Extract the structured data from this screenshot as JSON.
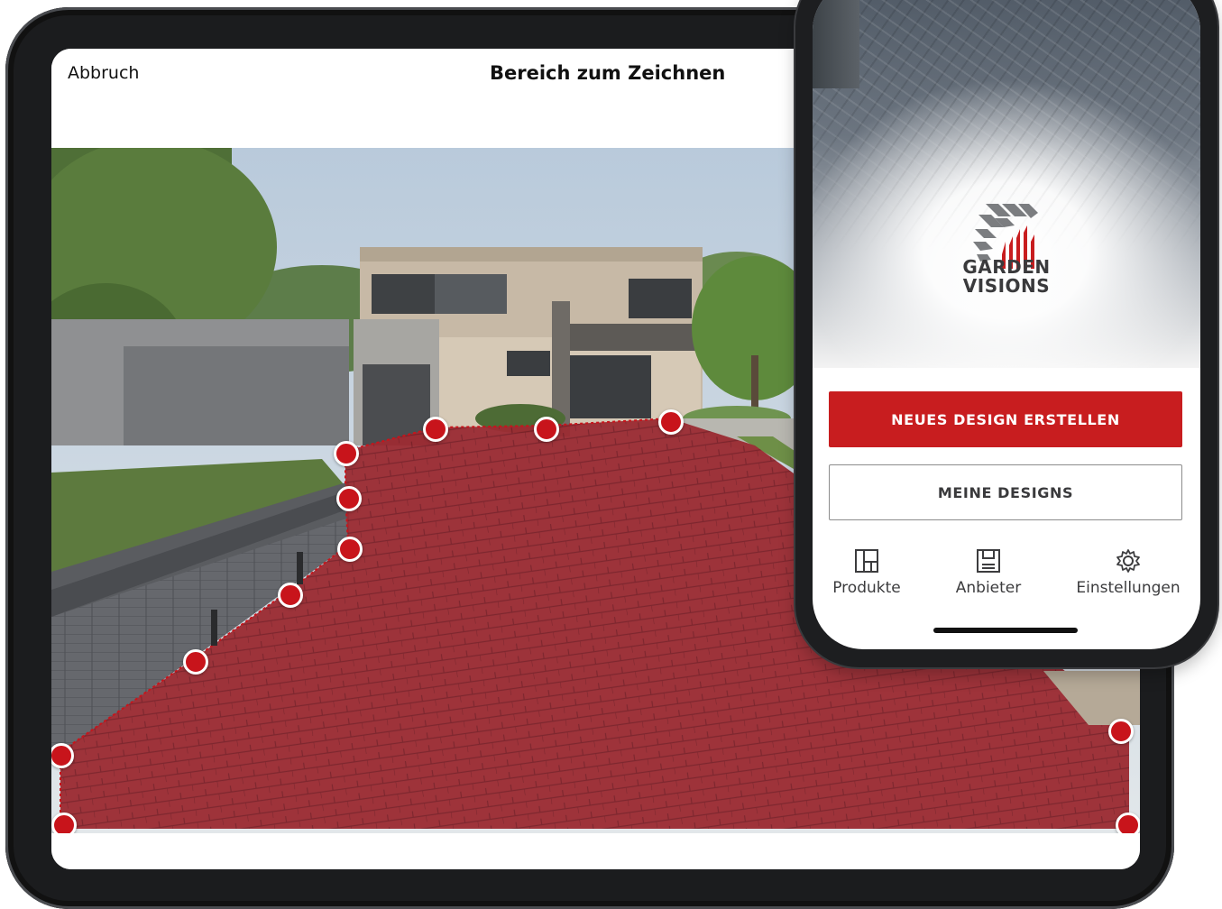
{
  "tablet": {
    "cancel_label": "Abbruch",
    "title": "Bereich zum Zeichnen",
    "overlay_color": "#9b1f2b",
    "handle_color": "#c8141b"
  },
  "phone": {
    "brand_line1": "GARDEN",
    "brand_line2": "VISIONS",
    "primary_button": "NEUES DESIGN ERSTELLEN",
    "secondary_button": "MEINE DESIGNS",
    "accent_color": "#c81d1f",
    "tabs": [
      {
        "label": "Produkte",
        "icon": "layout-grid-icon"
      },
      {
        "label": "Anbieter",
        "icon": "floppy-disk-icon"
      },
      {
        "label": "Einstellungen",
        "icon": "gear-icon"
      }
    ]
  }
}
